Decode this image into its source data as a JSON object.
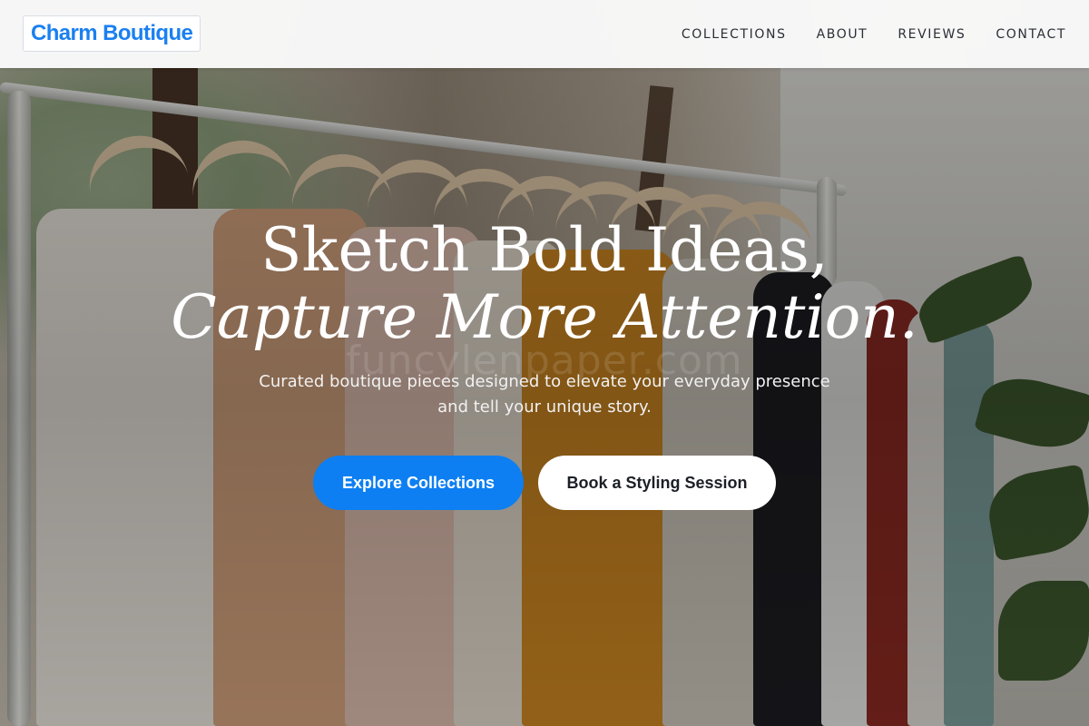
{
  "brand": {
    "name": "Charm Boutique",
    "color": "#1a80f0"
  },
  "nav": {
    "items": [
      "COLLECTIONS",
      "ABOUT",
      "REVIEWS",
      "CONTACT"
    ]
  },
  "hero": {
    "headline_line1": "Sketch Bold Ideas,",
    "headline_line2": "Capture More Attention.",
    "subtext_line1": "Curated boutique pieces designed to elevate your everyday presence",
    "subtext_line2": "and tell your unique story.",
    "primary_button": "Explore Collections",
    "secondary_button": "Book a Styling Session",
    "primary_color": "#0d7ff2",
    "watermark": "funcylenpaper.com"
  }
}
